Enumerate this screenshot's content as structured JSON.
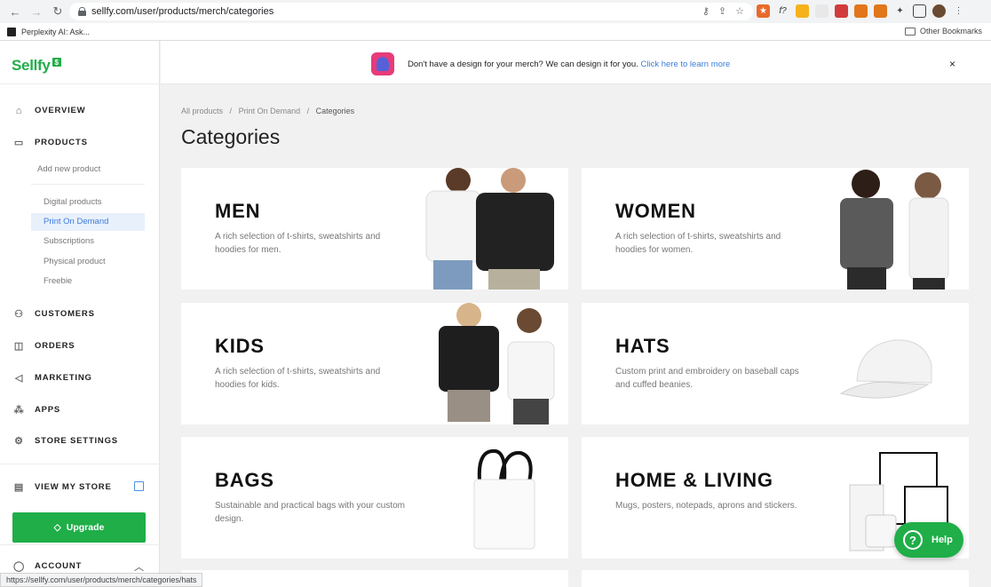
{
  "browser": {
    "url": "sellfy.com/user/products/merch/categories",
    "bookmark": "Perplexity AI: Ask...",
    "other_bookmarks": "Other Bookmarks",
    "status_url": "https://sellfy.com/user/products/merch/categories/hats"
  },
  "sidebar": {
    "logo": "Sellfy",
    "logo_badge": "$",
    "overview": "OVERVIEW",
    "products": "PRODUCTS",
    "add_new_product": "Add new product",
    "sub_items": [
      "Digital products",
      "Print On Demand",
      "Subscriptions",
      "Physical product",
      "Freebie"
    ],
    "customers": "CUSTOMERS",
    "orders": "ORDERS",
    "marketing": "MARKETING",
    "apps": "APPS",
    "store_settings": "STORE SETTINGS",
    "view_my_store": "VIEW MY STORE",
    "upgrade": "Upgrade",
    "account": "ACCOUNT"
  },
  "banner": {
    "text": "Don't have a design for your merch? We can design it for you.",
    "link": "Click here to learn more",
    "close": "×"
  },
  "breadcrumb": {
    "all_products": "All products",
    "sep": "/",
    "print_on_demand": "Print On Demand",
    "current": "Categories"
  },
  "page_title": "Categories",
  "cards": [
    {
      "title": "MEN",
      "desc": "A rich selection of t-shirts, sweatshirts and hoodies for men."
    },
    {
      "title": "WOMEN",
      "desc": "A rich selection of t-shirts, sweatshirts and hoodies for women."
    },
    {
      "title": "KIDS",
      "desc": "A rich selection of t-shirts, sweatshirts and hoodies for kids."
    },
    {
      "title": "HATS",
      "desc": "Custom print and embroidery on baseball caps and cuffed beanies."
    },
    {
      "title": "BAGS",
      "desc": "Sustainable and practical bags with your custom design."
    },
    {
      "title": "HOME & LIVING",
      "desc": "Mugs, posters, notepads, aprons and stickers."
    }
  ],
  "help": {
    "icon": "?",
    "label": "Help"
  }
}
